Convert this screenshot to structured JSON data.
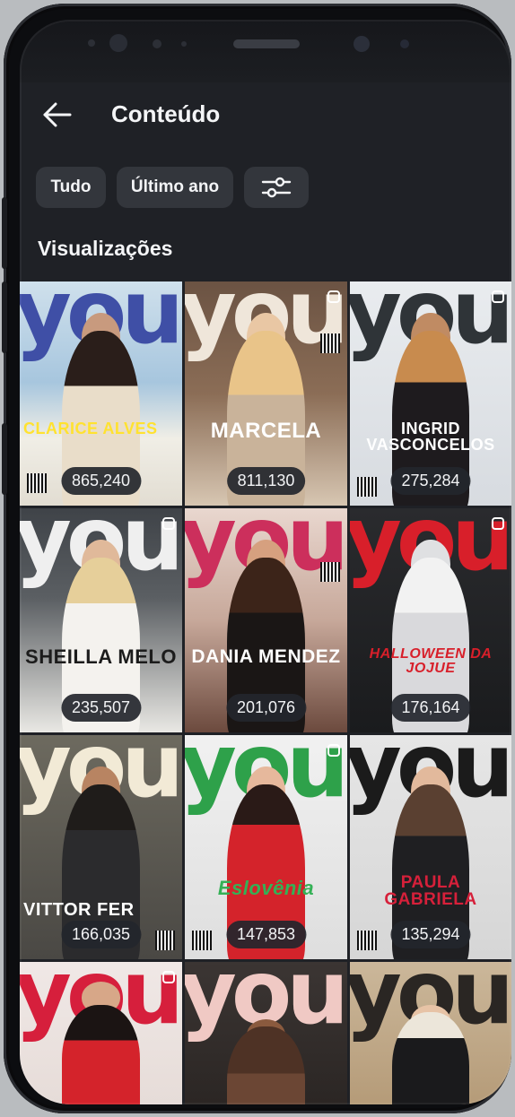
{
  "header": {
    "title": "Conteúdo"
  },
  "filters": {
    "all_label": "Tudo",
    "period_label": "Último ano"
  },
  "section": {
    "title": "Visualizações"
  },
  "colors": {
    "background": "#1f2126",
    "chip": "#33363c",
    "text": "#f4f5f7",
    "badge": "#23262c"
  },
  "icons": {
    "back": "arrow-left-icon",
    "filter": "sliders-icon",
    "multi": "multiple-media-icon"
  },
  "posts": [
    {
      "masthead": "your",
      "cover_name": "CLARICE ALVES",
      "views": "865,240"
    },
    {
      "masthead": "your",
      "cover_name": "MARCELA",
      "views": "811,130"
    },
    {
      "masthead": "your",
      "cover_name": "INGRID VASCONCELOS",
      "views": "275,284"
    },
    {
      "masthead": "your",
      "cover_name": "SHEILLA MELO",
      "views": "235,507"
    },
    {
      "masthead": "your",
      "cover_name": "DANIA MENDEZ",
      "views": "201,076"
    },
    {
      "masthead": "your",
      "cover_name": "HALLOWEEN DA JOJUE",
      "views": "176,164"
    },
    {
      "masthead": "your",
      "cover_name": "VITTOR FER",
      "views": "166,035"
    },
    {
      "masthead": "your",
      "cover_name": "Eslovênia",
      "views": "147,853"
    },
    {
      "masthead": "your",
      "cover_name": "PAULA GABRIELA",
      "views": "135,294"
    },
    {
      "masthead": "your",
      "cover_name": "",
      "views": ""
    },
    {
      "masthead": "your",
      "cover_name": "",
      "views": ""
    },
    {
      "masthead": "your",
      "cover_name": "",
      "views": ""
    }
  ]
}
